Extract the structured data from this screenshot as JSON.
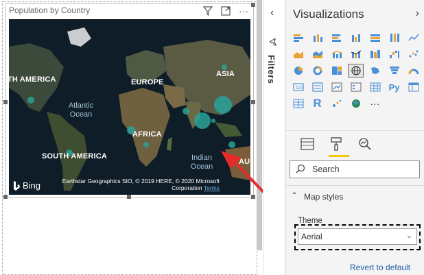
{
  "visual": {
    "title": "Population by Country",
    "icons": [
      "filter-icon",
      "focus-mode-icon",
      "more-options-icon"
    ]
  },
  "map": {
    "labels": {
      "north_america": "TH AMERICA",
      "europe": "EUROPE",
      "asia": "ASIA",
      "africa": "AFRICA",
      "south_america": "SOUTH AMERICA",
      "australia": "AUS"
    },
    "oceans": {
      "atlantic": "Atlantic\nOcean",
      "indian": "Indian\nOcean"
    },
    "bing": "Bing",
    "copyright": "Earthstar Geographics SIO, © 2019 HERE, © 2020 Microsoft Corporation",
    "terms": "Terms",
    "bubble_color": "#2aa198"
  },
  "filters": {
    "label": "Filters"
  },
  "visualizations": {
    "title": "Visualizations",
    "search_placeholder": "Search",
    "section_title": "Map styles",
    "theme_label": "Theme",
    "theme_value": "Aerial",
    "revert": "Revert to default"
  },
  "colors": {
    "accent_yellow": "#f2c811",
    "arrow_red": "#e52b2b",
    "link_blue": "#1f5aa8"
  }
}
